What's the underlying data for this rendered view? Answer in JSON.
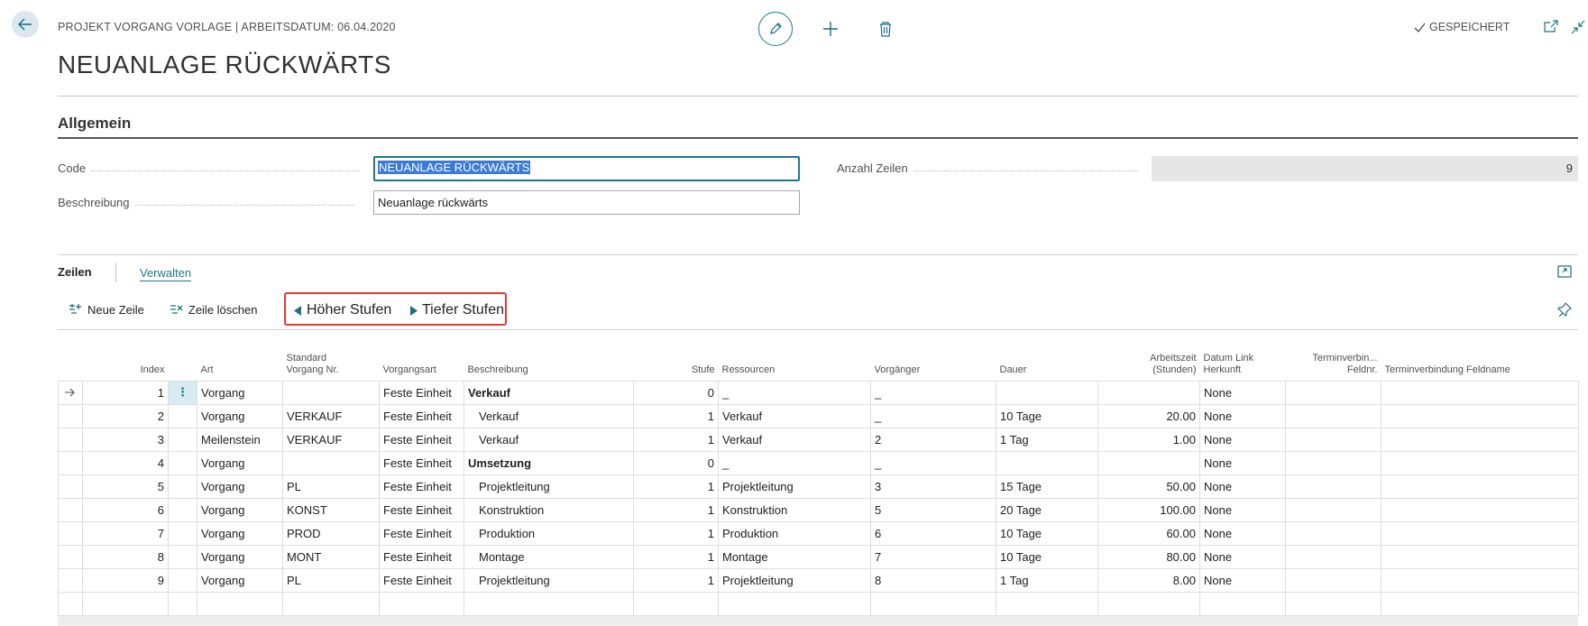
{
  "header": {
    "breadcrumb": "PROJEKT VORGANG VORLAGE | ARBEITSDATUM: 06.04.2020",
    "title": "NEUANLAGE RÜCKWÄRTS",
    "saved_label": "GESPEICHERT"
  },
  "general": {
    "section_title": "Allgemein",
    "code_label": "Code",
    "code_value": "NEUANLAGE RÜCKWÄRTS",
    "description_label": "Beschreibung",
    "description_value": "Neuanlage rückwärts",
    "count_label": "Anzahl Zeilen",
    "count_value": "9"
  },
  "lines": {
    "tab_lines": "Zeilen",
    "tab_manage": "Verwalten",
    "toolbar": {
      "new_line": "Neue Zeile",
      "delete_line": "Zeile löschen",
      "promote": "Höher Stufen",
      "demote": "Tiefer Stufen"
    },
    "columns": {
      "index": "Index",
      "art": "Art",
      "std_no_1": "Standard",
      "std_no_2": "Vorgang Nr.",
      "type": "Vorgangsart",
      "desc": "Beschreibung",
      "level": "Stufe",
      "resources": "Ressourcen",
      "predecessor": "Vorgänger",
      "duration": "Dauer",
      "hours_1": "Arbeitszeit",
      "hours_2": "(Stunden)",
      "date_link_1": "Datum Link",
      "date_link_2": "Herkunft",
      "term_field_no_1": "Terminverbin...",
      "term_field_no_2": "Feldnr.",
      "term_field_name": "Terminverbindung Feldname"
    },
    "rows": [
      {
        "index": "1",
        "art": "Vorgang",
        "std": "",
        "type": "Feste Einheit",
        "desc": "Verkauf",
        "level": "0",
        "res": "_",
        "pred": "_",
        "dur": "",
        "hours": "",
        "date_link": "None",
        "tf_no": "",
        "tf_name": ""
      },
      {
        "index": "2",
        "art": "Vorgang",
        "std": "VERKAUF",
        "type": "Feste Einheit",
        "desc": "Verkauf",
        "level": "1",
        "res": "Verkauf",
        "pred": "_",
        "dur": "10 Tage",
        "hours": "20.00",
        "date_link": "None",
        "tf_no": "",
        "tf_name": ""
      },
      {
        "index": "3",
        "art": "Meilenstein",
        "std": "VERKAUF",
        "type": "Feste Einheit",
        "desc": "Verkauf",
        "level": "1",
        "res": "Verkauf",
        "pred": "2",
        "dur": "1 Tag",
        "hours": "1.00",
        "date_link": "None",
        "tf_no": "",
        "tf_name": ""
      },
      {
        "index": "4",
        "art": "Vorgang",
        "std": "",
        "type": "Feste Einheit",
        "desc": "Umsetzung",
        "level": "0",
        "res": "_",
        "pred": "_",
        "dur": "",
        "hours": "",
        "date_link": "None",
        "tf_no": "",
        "tf_name": ""
      },
      {
        "index": "5",
        "art": "Vorgang",
        "std": "PL",
        "type": "Feste Einheit",
        "desc": "Projektleitung",
        "level": "1",
        "res": "Projektleitung",
        "pred": "3",
        "dur": "15 Tage",
        "hours": "50.00",
        "date_link": "None",
        "tf_no": "",
        "tf_name": ""
      },
      {
        "index": "6",
        "art": "Vorgang",
        "std": "KONST",
        "type": "Feste Einheit",
        "desc": "Konstruktion",
        "level": "1",
        "res": "Konstruktion",
        "pred": "5",
        "dur": "20 Tage",
        "hours": "100.00",
        "date_link": "None",
        "tf_no": "",
        "tf_name": ""
      },
      {
        "index": "7",
        "art": "Vorgang",
        "std": "PROD",
        "type": "Feste Einheit",
        "desc": "Produktion",
        "level": "1",
        "res": "Produktion",
        "pred": "6",
        "dur": "10 Tage",
        "hours": "60.00",
        "date_link": "None",
        "tf_no": "",
        "tf_name": ""
      },
      {
        "index": "8",
        "art": "Vorgang",
        "std": "MONT",
        "type": "Feste Einheit",
        "desc": "Montage",
        "level": "1",
        "res": "Montage",
        "pred": "7",
        "dur": "10 Tage",
        "hours": "80.00",
        "date_link": "None",
        "tf_no": "",
        "tf_name": ""
      },
      {
        "index": "9",
        "art": "Vorgang",
        "std": "PL",
        "type": "Feste Einheit",
        "desc": "Projektleitung",
        "level": "1",
        "res": "Projektleitung",
        "pred": "8",
        "dur": "1 Tag",
        "hours": "8.00",
        "date_link": "None",
        "tf_no": "",
        "tf_name": ""
      }
    ]
  }
}
